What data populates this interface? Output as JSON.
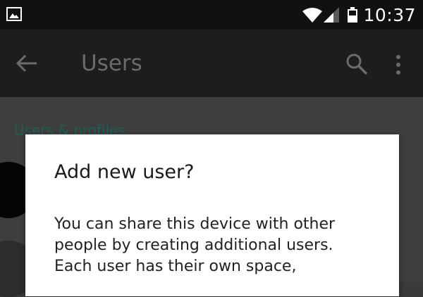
{
  "status_bar": {
    "time": "10:37",
    "icons": [
      "image-notification-icon",
      "wifi-icon",
      "cell-signal-icon",
      "battery-icon"
    ]
  },
  "action_bar": {
    "title": "Users",
    "icons": [
      "back-arrow-icon",
      "search-icon",
      "overflow-menu-icon"
    ]
  },
  "content": {
    "section_header": "Users & profiles"
  },
  "dialog": {
    "title": "Add new user?",
    "message_lines": [
      "You can share this device with other",
      "people by creating additional users.",
      "Each user has their own space,"
    ]
  },
  "colors": {
    "status_bar_bg": "#111111",
    "action_bar_bg": "#1d1d1d",
    "scrim_bg": "#3e3e3e",
    "accent_teal": "#1f5f55",
    "dialog_bg": "#ffffff"
  }
}
